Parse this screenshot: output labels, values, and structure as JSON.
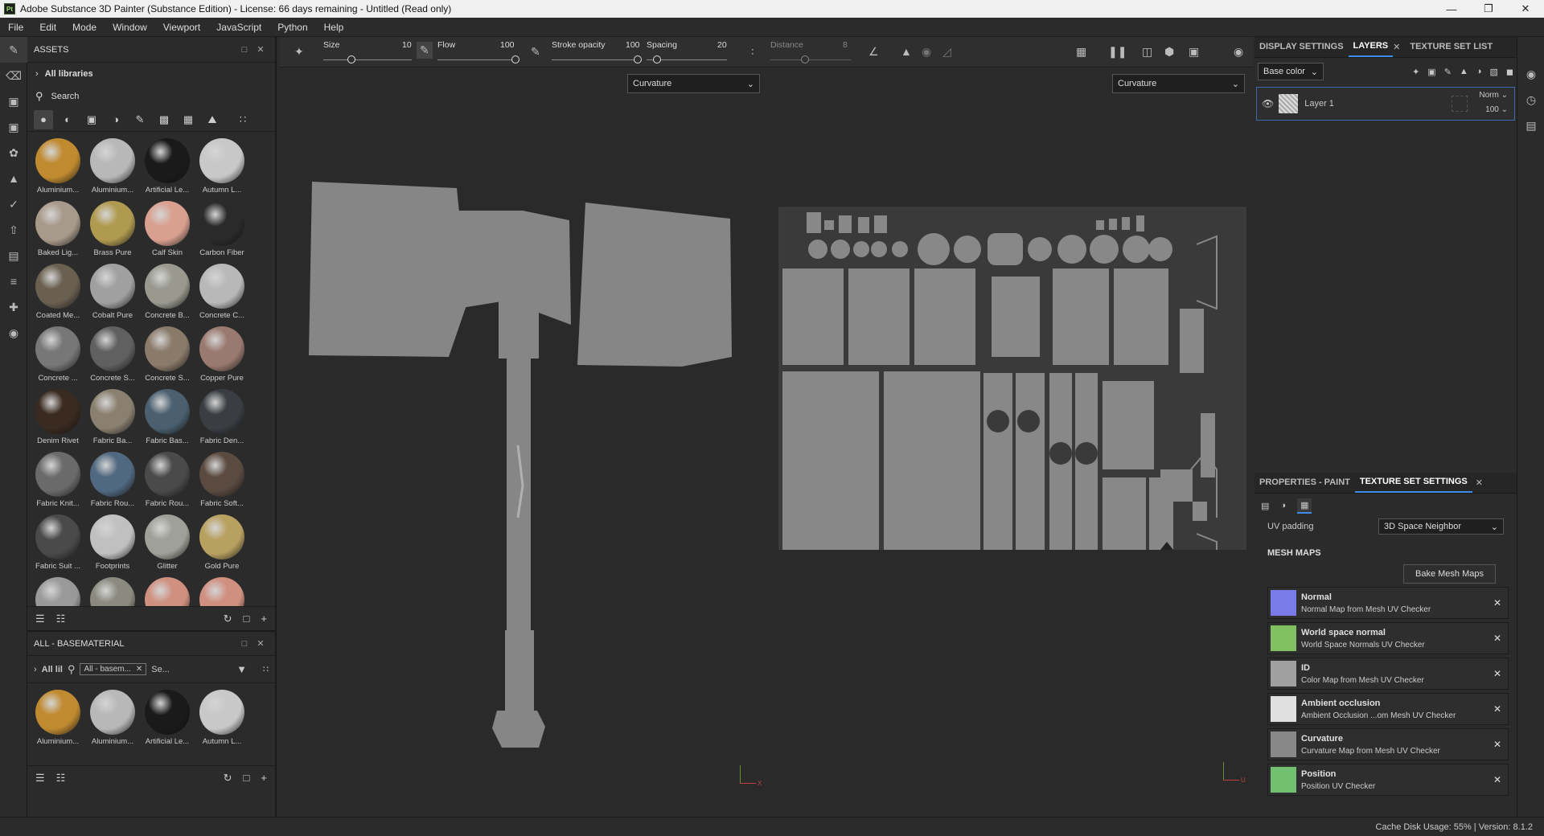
{
  "window": {
    "title": "Adobe Substance 3D Painter (Substance Edition) - License: 66 days remaining - Untitled (Read only)",
    "app_icon": "Pt"
  },
  "menu": [
    "File",
    "Edit",
    "Mode",
    "Window",
    "Viewport",
    "JavaScript",
    "Python",
    "Help"
  ],
  "assets": {
    "title": "ASSETS",
    "all_libraries": "All libraries",
    "search_placeholder": "Search",
    "materials": [
      {
        "name": "Aluminium...",
        "color": "#c08a30"
      },
      {
        "name": "Aluminium...",
        "color": "#b8b8b8"
      },
      {
        "name": "Artificial Le...",
        "color": "#1a1a1a"
      },
      {
        "name": "Autumn L...",
        "color": "#c8c8c8"
      },
      {
        "name": "Baked Lig...",
        "color": "#a89a8a"
      },
      {
        "name": "Brass Pure",
        "color": "#b09a50"
      },
      {
        "name": "Calf Skin",
        "color": "#d9a090"
      },
      {
        "name": "Carbon Fiber",
        "color": "#2a2a2a"
      },
      {
        "name": "Coated Me...",
        "color": "#6a6050"
      },
      {
        "name": "Cobalt Pure",
        "color": "#a0a0a0"
      },
      {
        "name": "Concrete B...",
        "color": "#999990"
      },
      {
        "name": "Concrete C...",
        "color": "#b8b8b8"
      },
      {
        "name": "Concrete ...",
        "color": "#777777"
      },
      {
        "name": "Concrete S...",
        "color": "#606060"
      },
      {
        "name": "Concrete S...",
        "color": "#8a7a6a"
      },
      {
        "name": "Copper Pure",
        "color": "#9a7a70"
      },
      {
        "name": "Denim Rivet",
        "color": "#3a2a20"
      },
      {
        "name": "Fabric Ba...",
        "color": "#8a8070"
      },
      {
        "name": "Fabric Bas...",
        "color": "#4a6070"
      },
      {
        "name": "Fabric Den...",
        "color": "#3a3e42"
      },
      {
        "name": "Fabric Knit...",
        "color": "#6a6a6a"
      },
      {
        "name": "Fabric Rou...",
        "color": "#506880"
      },
      {
        "name": "Fabric Rou...",
        "color": "#4a4a4a"
      },
      {
        "name": "Fabric Soft...",
        "color": "#5a4a40"
      },
      {
        "name": "Fabric Suit ...",
        "color": "#4a4a4a"
      },
      {
        "name": "Footprints",
        "color": "#c0c0c0"
      },
      {
        "name": "Glitter",
        "color": "#a0a09a"
      },
      {
        "name": "Gold Pure",
        "color": "#b8a060"
      },
      {
        "name": "",
        "color": "#999999"
      },
      {
        "name": "",
        "color": "#8a8a80"
      },
      {
        "name": "",
        "color": "#d09080"
      },
      {
        "name": "",
        "color": "#d09080"
      }
    ]
  },
  "basematerial": {
    "title": "ALL - BASEMATERIAL",
    "all_label": "All lil",
    "tag": "All - basem...",
    "search_short": "Se...",
    "materials": [
      {
        "name": "Aluminium...",
        "color": "#c08a30"
      },
      {
        "name": "Aluminium...",
        "color": "#b8b8b8"
      },
      {
        "name": "Artificial Le...",
        "color": "#1a1a1a"
      },
      {
        "name": "Autumn L...",
        "color": "#c8c8c8"
      }
    ]
  },
  "toolbar": {
    "size_label": "Size",
    "size_value": "10",
    "flow_label": "Flow",
    "flow_value": "100",
    "opacity_label": "Stroke opacity",
    "opacity_value": "100",
    "spacing_label": "Spacing",
    "spacing_value": "20",
    "distance_label": "Distance",
    "distance_value": "8"
  },
  "viewport": {
    "left_channel": "Curvature",
    "right_channel": "Curvature",
    "axis_3d": "X",
    "axis_2d": "U"
  },
  "layers": {
    "tabs": [
      "DISPLAY SETTINGS",
      "LAYERS",
      "TEXTURE SET LIST"
    ],
    "channel": "Base color",
    "layer_name": "Layer 1",
    "blend_mode": "Norm",
    "opacity": "100"
  },
  "properties": {
    "tabs": [
      "PROPERTIES - PAINT",
      "TEXTURE SET SETTINGS"
    ],
    "uv_padding_label": "UV padding",
    "uv_padding_value": "3D Space Neighbor",
    "mesh_maps_title": "MESH MAPS",
    "bake_button": "Bake Mesh Maps",
    "mesh_maps": [
      {
        "name": "Normal",
        "source": "Normal Map from Mesh UV Checker",
        "color": "#7a7ae8"
      },
      {
        "name": "World space normal",
        "source": "World Space Normals UV Checker",
        "color": "#80c060"
      },
      {
        "name": "ID",
        "source": "Color Map from Mesh UV Checker",
        "color": "#a0a0a0"
      },
      {
        "name": "Ambient occlusion",
        "source": "Ambient Occlusion ...om Mesh UV Checker",
        "color": "#e0e0e0"
      },
      {
        "name": "Curvature",
        "source": "Curvature Map from Mesh UV Checker",
        "color": "#888888"
      },
      {
        "name": "Position",
        "source": "Position UV Checker",
        "color": "#70c070"
      }
    ]
  },
  "status": {
    "text": "Cache Disk Usage:   55% | Version: 8.1.2"
  }
}
